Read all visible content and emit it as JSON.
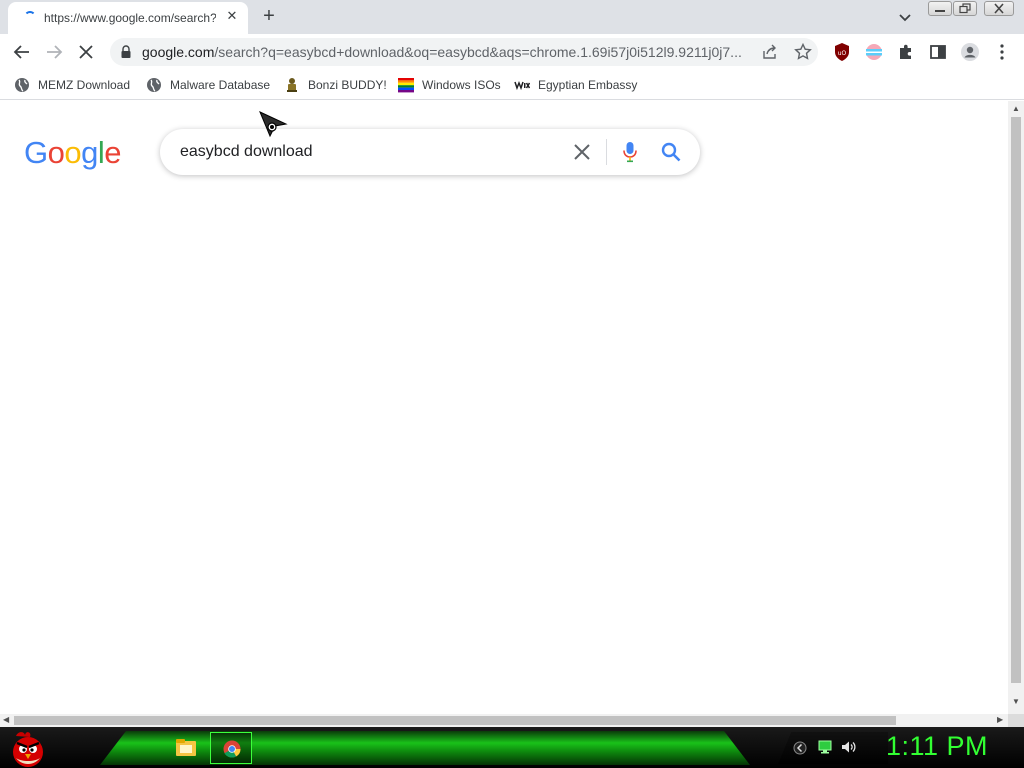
{
  "browser": {
    "tab": {
      "title": "https://www.google.com/search?q=easybcd+download",
      "close_glyph": "✕"
    },
    "new_tab_glyph": "+",
    "url_host": "google.com",
    "url_rest": "/search?q=easybcd+download&oq=easybcd&aqs=chrome.1.69i57j0i512l9.9211j0j7..."
  },
  "bookmarks": [
    {
      "label": "MEMZ Download",
      "icon": "globe-icon"
    },
    {
      "label": "Malware Database",
      "icon": "globe-icon"
    },
    {
      "label": "Bonzi BUDDY!",
      "icon": "bonzi-icon"
    },
    {
      "label": "Windows ISOs",
      "icon": "rainbow-flag-icon"
    },
    {
      "label": "Egyptian Embassy",
      "icon": "wix-icon"
    }
  ],
  "search": {
    "query": "easybcd download",
    "logo_letters": [
      "G",
      "o",
      "o",
      "g",
      "l",
      "e"
    ],
    "logo_colors": [
      "#4285F4",
      "#EA4335",
      "#FBBC05",
      "#4285F4",
      "#34A853",
      "#EA4335"
    ]
  },
  "taskbar": {
    "clock": "1:11 PM",
    "clock_color": "#32ff32"
  },
  "colors": {
    "accent": "#1a73e8",
    "tabstrip": "#dee1e6"
  }
}
